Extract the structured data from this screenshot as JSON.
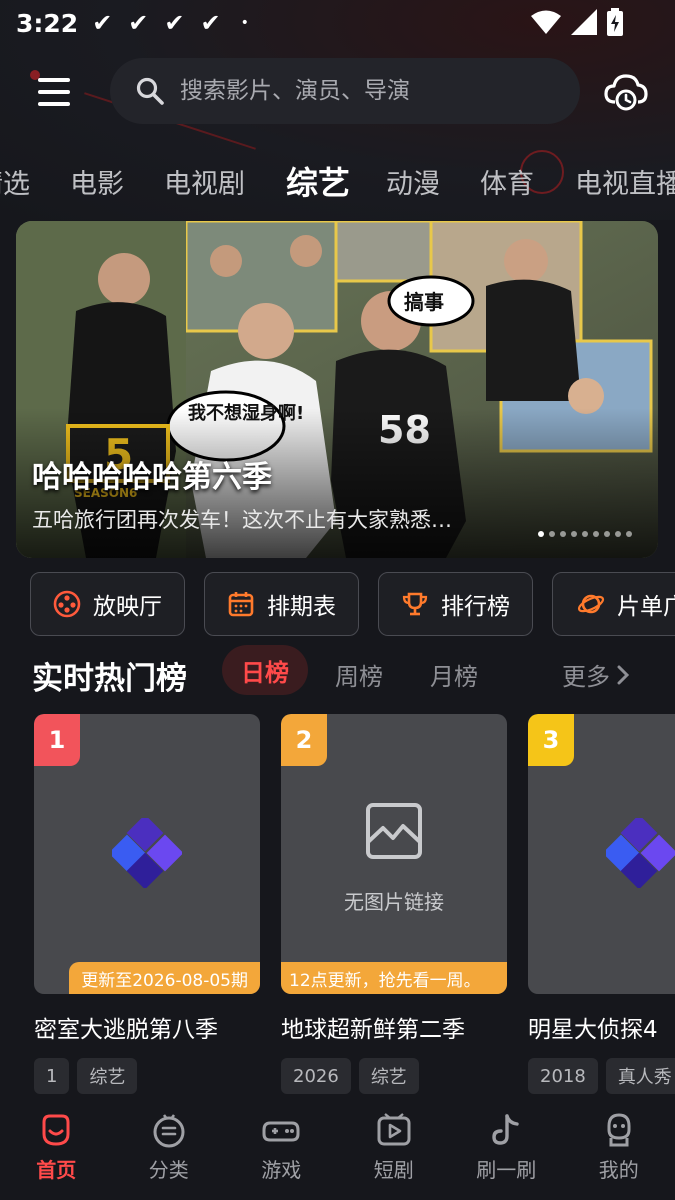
{
  "status_bar": {
    "time": "3:22",
    "notifications": [
      "✔",
      "✔",
      "✔",
      "✔"
    ],
    "dot": "•"
  },
  "header": {
    "menu_icon": "hamburger-menu-icon",
    "search_placeholder": "搜索影片、演员、导演",
    "search_icon": "search-icon",
    "cloud_icon": "cloud-history-icon"
  },
  "category_tabs": [
    {
      "label": "精选",
      "active": false
    },
    {
      "label": "电影",
      "active": false
    },
    {
      "label": "电视剧",
      "active": false
    },
    {
      "label": "综艺",
      "active": true
    },
    {
      "label": "动漫",
      "active": false
    },
    {
      "label": "体育",
      "active": false
    },
    {
      "label": "电视直播",
      "active": false
    }
  ],
  "banner": {
    "title": "哈哈哈哈哈第六季",
    "subtitle": "五哈旅行团再次发车！这次不止有大家熟悉…",
    "sticker_1": "搞事",
    "sticker_2": "我不想湿身啊!",
    "logo_text": "5",
    "season_text": "SEASON6",
    "jersey_number": "58",
    "dots_total": 9,
    "dots_active": 0
  },
  "quick_entries": [
    {
      "label": "放映厅",
      "icon": "film-reel-icon"
    },
    {
      "label": "排期表",
      "icon": "calendar-icon"
    },
    {
      "label": "排行榜",
      "icon": "trophy-icon"
    },
    {
      "label": "片单广场",
      "icon": "planet-icon"
    }
  ],
  "hot_list": {
    "title": "实时热门榜",
    "tabs": [
      {
        "label": "日榜",
        "active": true
      },
      {
        "label": "周榜",
        "active": false
      },
      {
        "label": "月榜",
        "active": false
      }
    ],
    "more_label": "更多"
  },
  "cards": [
    {
      "rank": "1",
      "title": "密室大逃脱第八季",
      "update": "更新至2026-08-05期",
      "tags": [
        "1",
        "综艺"
      ],
      "rank_color": "#f2545b",
      "poster": "placeholder-logo"
    },
    {
      "rank": "2",
      "title": "地球超新鲜第二季",
      "update": "12点更新，抢先看一周。",
      "tags": [
        "2026",
        "综艺"
      ],
      "rank_color": "#f3a73a",
      "poster": "no-image",
      "no_image_text": "无图片链接"
    },
    {
      "rank": "3",
      "title": "明星大侦探4",
      "update": "",
      "tags": [
        "2018",
        "真人秀"
      ],
      "rank_color": "#f5c518",
      "poster": "placeholder-logo"
    }
  ],
  "bottom_nav": [
    {
      "label": "首页",
      "icon": "home-icon",
      "active": true
    },
    {
      "label": "分类",
      "icon": "category-icon",
      "active": false
    },
    {
      "label": "游戏",
      "icon": "gamepad-icon",
      "active": false
    },
    {
      "label": "短剧",
      "icon": "short-drama-icon",
      "active": false
    },
    {
      "label": "刷一刷",
      "icon": "tiktok-note-icon",
      "active": false
    },
    {
      "label": "我的",
      "icon": "profile-icon",
      "active": false
    }
  ],
  "colors": {
    "accent": "#ff4a4a",
    "background": "#16171c",
    "update_badge": "#f3a73a"
  }
}
